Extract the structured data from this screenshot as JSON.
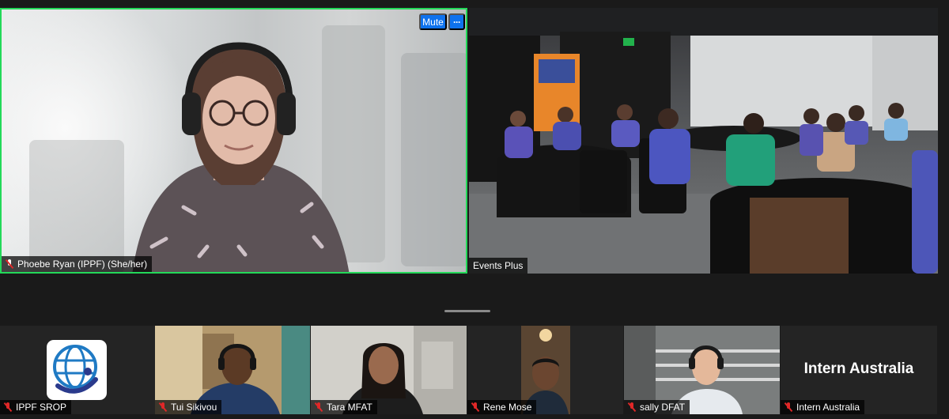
{
  "main": {
    "left_tile": {
      "name": "Phoebe Ryan (IPPF) (She/her)",
      "mute_label": "Mute",
      "more_label": "···"
    },
    "right_tile": {
      "name": "Events Plus"
    }
  },
  "gallery": [
    {
      "name": "IPPF SROP",
      "kind": "logo"
    },
    {
      "name": "Tui Sikivou",
      "kind": "video"
    },
    {
      "name": "Tara MFAT",
      "kind": "video"
    },
    {
      "name": "Rene Mose",
      "kind": "video"
    },
    {
      "name": "sally DFAT",
      "kind": "video"
    },
    {
      "name": "Intern Australia",
      "kind": "text",
      "display_text": "Intern Australia"
    }
  ],
  "colors": {
    "active_speaker_border": "#23d959",
    "button_blue": "#0e72ed",
    "muted_red": "#e02828",
    "background": "#1a1a1a"
  }
}
